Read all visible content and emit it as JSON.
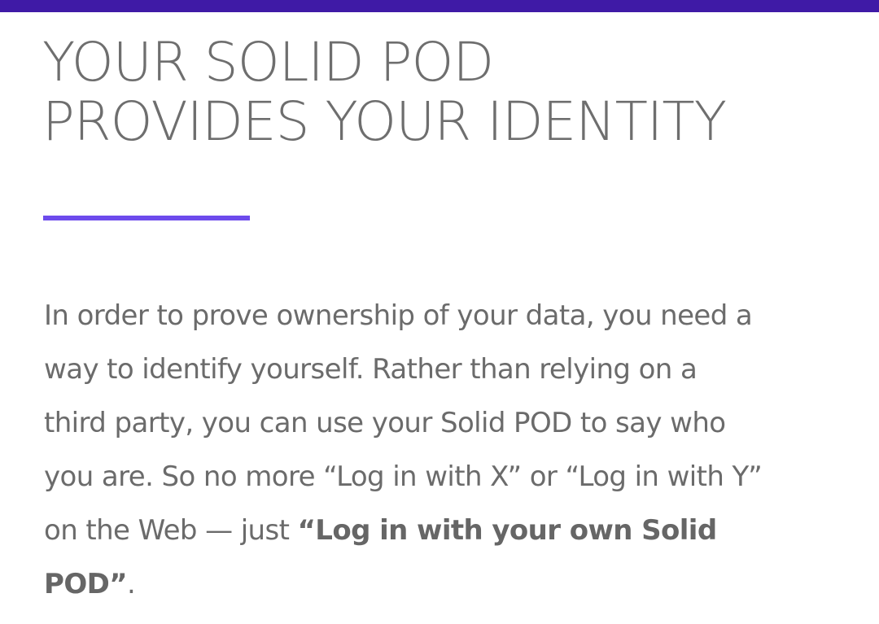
{
  "theme": {
    "top_bar_color": "#3f1aa6",
    "accent_color": "#6d4bec",
    "text_color": "#6b6b6b"
  },
  "section": {
    "heading_lines": [
      "YOUR SOLID POD",
      "PROVIDES YOUR IDENTITY"
    ],
    "body": {
      "line1": "In order to prove ownership of your data, you need a",
      "line2": "way to identify yourself. Rather than relying on a",
      "line3": "third party, you can use your Solid POD to say who",
      "line4": "you are. So no more “Log in with X” or “Log in with Y”",
      "line5_plain": "on the Web — just ",
      "line5_bold": "“Log in with your own Solid",
      "line6_bold": "POD”",
      "line6_plain": "."
    }
  }
}
